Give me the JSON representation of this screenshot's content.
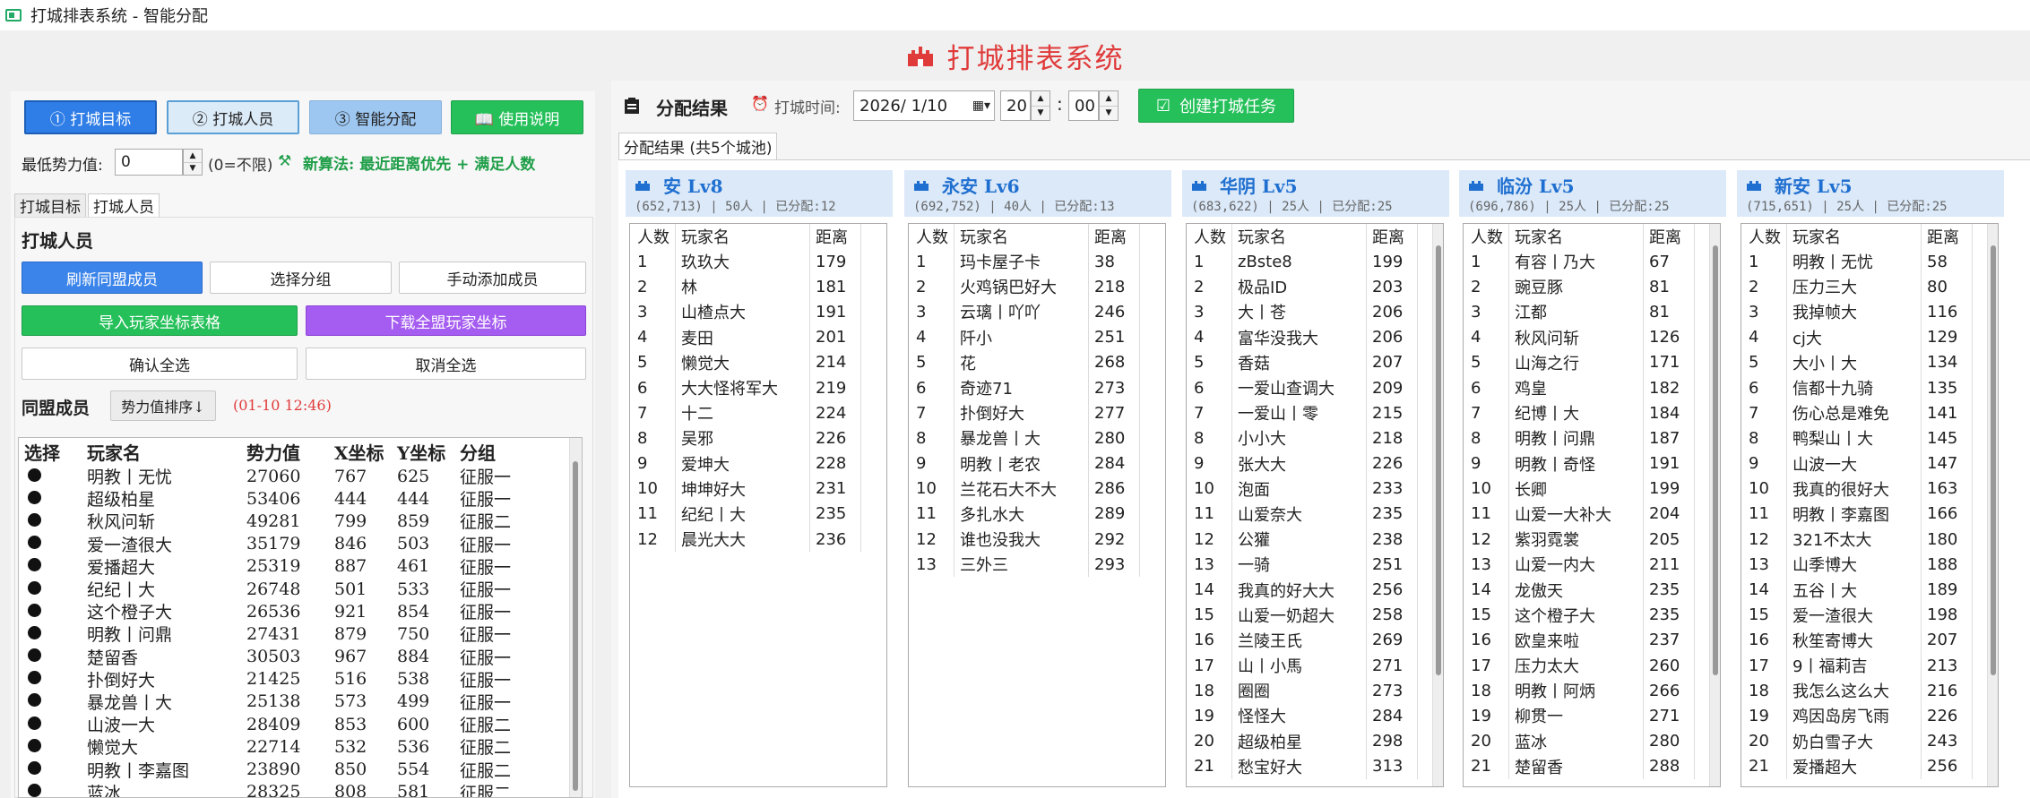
{
  "window": {
    "title": "打城排表系统 - 智能分配"
  },
  "banner": {
    "title": "打城排表系统"
  },
  "top_buttons": [
    {
      "label": "① 打城目标"
    },
    {
      "label": "② 打城人员"
    },
    {
      "label": "③ 智能分配"
    },
    {
      "label": "📖 使用说明"
    }
  ],
  "power": {
    "label": "最低势力值:",
    "value": "0",
    "hint": "(0=不限)",
    "algo": "新算法: 最近距离优先 + 满足人数"
  },
  "left_tabs": [
    {
      "label": "打城目标"
    },
    {
      "label": "打城人员"
    }
  ],
  "section": {
    "title": "打城人员"
  },
  "actions": {
    "refresh": "刷新同盟成员",
    "select_group": "选择分组",
    "manual_add": "手动添加成员",
    "import": "导入玩家坐标表格",
    "download": "下载全盟玩家坐标",
    "select_all": "确认全选",
    "cancel_all": "取消全选"
  },
  "members": {
    "label": "同盟成员",
    "sort_label": "势力值排序↓",
    "timestamp": "(01-10 12:46)",
    "columns": [
      "选择",
      "玩家名",
      "势力值",
      "X坐标",
      "Y坐标",
      "分组"
    ],
    "rows": [
      [
        "明教丨无忧",
        "27060",
        "767",
        "625",
        "征服一"
      ],
      [
        "超级柏星",
        "53406",
        "444",
        "444",
        "征服一"
      ],
      [
        "秋风问斩",
        "49281",
        "799",
        "859",
        "征服二"
      ],
      [
        "爱一渣很大",
        "35179",
        "846",
        "503",
        "征服一"
      ],
      [
        "爱播超大",
        "25319",
        "887",
        "461",
        "征服一"
      ],
      [
        "纪纪丨大",
        "26748",
        "501",
        "533",
        "征服一"
      ],
      [
        "这个橙子大",
        "26536",
        "921",
        "854",
        "征服一"
      ],
      [
        "明教丨问鼎",
        "27431",
        "879",
        "750",
        "征服一"
      ],
      [
        "楚留香",
        "30503",
        "967",
        "884",
        "征服一"
      ],
      [
        "扑倒好大",
        "21425",
        "516",
        "538",
        "征服一"
      ],
      [
        "暴龙兽丨大",
        "25138",
        "573",
        "499",
        "征服一"
      ],
      [
        "山波一大",
        "28409",
        "853",
        "600",
        "征服二"
      ],
      [
        "懒觉大",
        "22714",
        "532",
        "536",
        "征服二"
      ],
      [
        "明教丨李嘉图",
        "23890",
        "850",
        "554",
        "征服二"
      ],
      [
        "蓝冰",
        "28325",
        "808",
        "581",
        "征服二"
      ]
    ]
  },
  "result": {
    "title": "分配结果",
    "time_label": "打城时间:",
    "date_value": "2026/ 1/10",
    "hour_value": "20",
    "minute_value": "00",
    "time_sep": ":",
    "create_button": "创建打城任务",
    "tab_label": "分配结果 (共5个城池)",
    "table_columns": [
      "人数",
      "玩家名",
      "距离"
    ]
  },
  "cities": [
    {
      "title": "安 Lv8",
      "info": "(652,713) | 50人 | 已分配:12",
      "rows": [
        [
          "1",
          "玖玖大",
          "179"
        ],
        [
          "2",
          "林",
          "181"
        ],
        [
          "3",
          "山楂点大",
          "191"
        ],
        [
          "4",
          "麦田",
          "201"
        ],
        [
          "5",
          "懒觉大",
          "214"
        ],
        [
          "6",
          "大大怪将军大",
          "219"
        ],
        [
          "7",
          "十二",
          "224"
        ],
        [
          "8",
          "吴邪",
          "226"
        ],
        [
          "9",
          "爱坤大",
          "228"
        ],
        [
          "10",
          "坤坤好大",
          "231"
        ],
        [
          "11",
          "纪纪丨大",
          "235"
        ],
        [
          "12",
          "晨光大大",
          "236"
        ]
      ]
    },
    {
      "title": "永安 Lv6",
      "info": "(692,752) | 40人 | 已分配:13",
      "rows": [
        [
          "1",
          "玛卡屋子卡",
          "38"
        ],
        [
          "2",
          "火鸡锅巴好大",
          "218"
        ],
        [
          "3",
          "云璃丨吖吖",
          "246"
        ],
        [
          "4",
          "阡小",
          "251"
        ],
        [
          "5",
          "花",
          "268"
        ],
        [
          "6",
          "奇迹71",
          "273"
        ],
        [
          "7",
          "扑倒好大",
          "277"
        ],
        [
          "8",
          "暴龙兽丨大",
          "280"
        ],
        [
          "9",
          "明教丨老农",
          "284"
        ],
        [
          "10",
          "兰花石大不大",
          "286"
        ],
        [
          "11",
          "多扎水大",
          "289"
        ],
        [
          "12",
          "谁也没我大",
          "292"
        ],
        [
          "13",
          "三外三",
          "293"
        ]
      ]
    },
    {
      "title": "华阴 Lv5",
      "info": "(683,622) | 25人 | 已分配:25",
      "rows": [
        [
          "1",
          "zBste8",
          "199"
        ],
        [
          "2",
          "极品ID",
          "203"
        ],
        [
          "3",
          "大丨苍",
          "206"
        ],
        [
          "4",
          "富华没我大",
          "206"
        ],
        [
          "5",
          "香菇",
          "207"
        ],
        [
          "6",
          "一爱山查调大",
          "209"
        ],
        [
          "7",
          "一爱山丨零",
          "215"
        ],
        [
          "8",
          "小小大",
          "218"
        ],
        [
          "9",
          "张大大",
          "226"
        ],
        [
          "10",
          "泡面",
          "233"
        ],
        [
          "11",
          "山爱奈大",
          "235"
        ],
        [
          "12",
          "公獾",
          "238"
        ],
        [
          "13",
          "一骑",
          "251"
        ],
        [
          "14",
          "我真的好大大",
          "256"
        ],
        [
          "15",
          "山爱一奶超大",
          "258"
        ],
        [
          "16",
          "兰陵王氏",
          "269"
        ],
        [
          "17",
          "山丨小馬",
          "271"
        ],
        [
          "18",
          "圈圈",
          "273"
        ],
        [
          "19",
          "怪怪大",
          "284"
        ],
        [
          "20",
          "超级柏星",
          "298"
        ],
        [
          "21",
          "愁宝好大",
          "313"
        ]
      ]
    },
    {
      "title": "临汾 Lv5",
      "info": "(696,786) | 25人 | 已分配:25",
      "rows": [
        [
          "1",
          "有容丨乃大",
          "67"
        ],
        [
          "2",
          "豌豆豚",
          "81"
        ],
        [
          "3",
          "江都",
          "81"
        ],
        [
          "4",
          "秋风问斩",
          "126"
        ],
        [
          "5",
          "山海之行",
          "171"
        ],
        [
          "6",
          "鸡皇",
          "182"
        ],
        [
          "7",
          "纪博丨大",
          "184"
        ],
        [
          "8",
          "明教丨问鼎",
          "187"
        ],
        [
          "9",
          "明教丨奇怪",
          "191"
        ],
        [
          "10",
          "长卿",
          "199"
        ],
        [
          "11",
          "山爱一大补大",
          "204"
        ],
        [
          "12",
          "紫羽霓裳",
          "205"
        ],
        [
          "13",
          "山爱一内大",
          "211"
        ],
        [
          "14",
          "龙傲天",
          "235"
        ],
        [
          "15",
          "这个橙子大",
          "235"
        ],
        [
          "16",
          "欧皇来啦",
          "237"
        ],
        [
          "17",
          "压力太大",
          "260"
        ],
        [
          "18",
          "明教丨阿炳",
          "266"
        ],
        [
          "19",
          "柳贯一",
          "271"
        ],
        [
          "20",
          "蓝冰",
          "280"
        ],
        [
          "21",
          "楚留香",
          "288"
        ]
      ]
    },
    {
      "title": "新安 Lv5",
      "info": "(715,651) | 25人 | 已分配:25",
      "rows": [
        [
          "1",
          "明教丨无忧",
          "58"
        ],
        [
          "2",
          "压力三大",
          "80"
        ],
        [
          "3",
          "我掉帧大",
          "116"
        ],
        [
          "4",
          "cj大",
          "129"
        ],
        [
          "5",
          "大小丨大",
          "134"
        ],
        [
          "6",
          "信都十九骑",
          "135"
        ],
        [
          "7",
          "伤心总是难免",
          "141"
        ],
        [
          "8",
          "鸭梨山丨大",
          "145"
        ],
        [
          "9",
          "山波一大",
          "147"
        ],
        [
          "10",
          "我真的很好大",
          "163"
        ],
        [
          "11",
          "明教丨李嘉图",
          "166"
        ],
        [
          "12",
          "321不太大",
          "180"
        ],
        [
          "13",
          "山季博大",
          "188"
        ],
        [
          "14",
          "五谷丨大",
          "189"
        ],
        [
          "15",
          "爱一渣很大",
          "198"
        ],
        [
          "16",
          "秋笙寄博大",
          "207"
        ],
        [
          "17",
          "9丨福莉吉",
          "213"
        ],
        [
          "18",
          "我怎么这么大",
          "216"
        ],
        [
          "19",
          "鸡因岛房飞雨",
          "226"
        ],
        [
          "20",
          "奶白雪子大",
          "243"
        ],
        [
          "21",
          "爱播超大",
          "256"
        ]
      ]
    }
  ],
  "colors": {
    "accent_red": "#e03b3b",
    "accent_blue": "#2f7de6",
    "accent_green": "#25c05a",
    "accent_purple": "#a55cf0",
    "city_blue": "#1f6fd0"
  }
}
